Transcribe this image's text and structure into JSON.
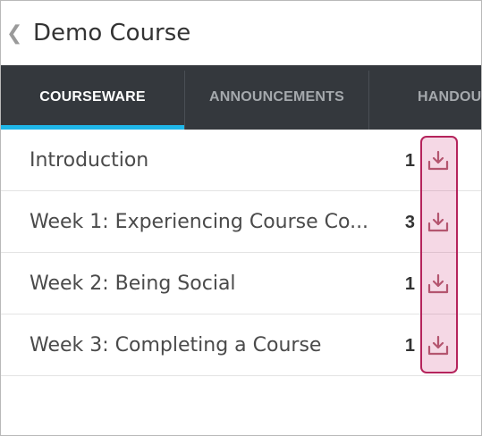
{
  "header": {
    "back_icon": "chevron-left-icon",
    "back_glyph": "❮",
    "title": "Demo Course"
  },
  "tabs": [
    {
      "label": "COURSEWARE",
      "active": true
    },
    {
      "label": "ANNOUNCEMENTS",
      "active": false
    },
    {
      "label": "HANDOU",
      "active": false
    }
  ],
  "sections": [
    {
      "title": "Introduction",
      "count": "1",
      "icon": "download-icon"
    },
    {
      "title": "Week 1: Experiencing Course Co...",
      "count": "3",
      "icon": "download-icon"
    },
    {
      "title": "Week 2: Being Social",
      "count": "1",
      "icon": "download-icon"
    },
    {
      "title": "Week 3: Completing a Course",
      "count": "1",
      "icon": "download-icon"
    }
  ],
  "colors": {
    "tab_bar": "#34383d",
    "active_underline": "#1fb6e8",
    "highlight_border": "#b5245c",
    "icon": "#b06070"
  }
}
